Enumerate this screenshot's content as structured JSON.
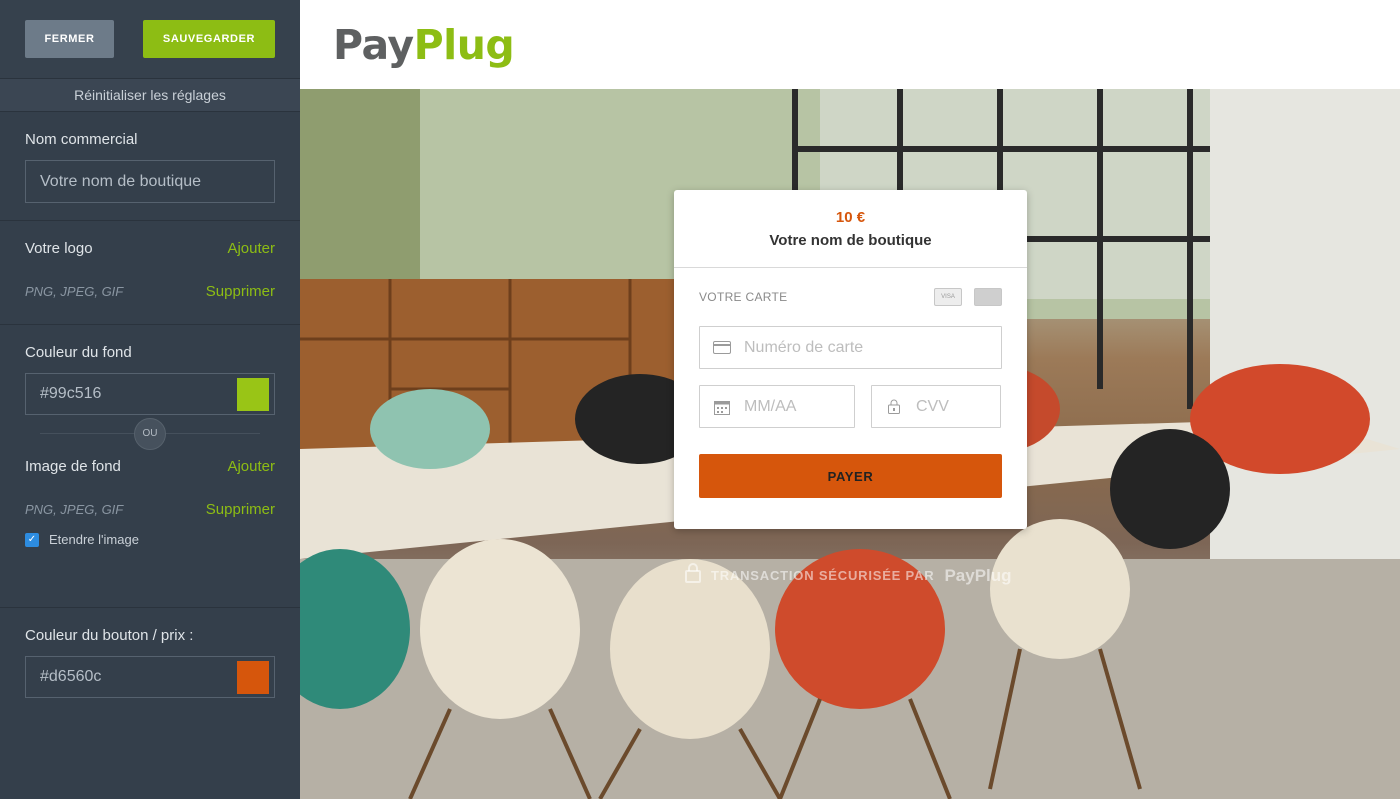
{
  "sidebar": {
    "close_label": "FERMER",
    "save_label": "SAUVEGARDER",
    "reset_label": "Réinitialiser les réglages",
    "commercial_name": {
      "label": "Nom commercial",
      "placeholder": "Votre nom de boutique"
    },
    "logo": {
      "label": "Votre logo",
      "add": "Ajouter",
      "formats": "PNG, JPEG, GIF",
      "remove": "Supprimer"
    },
    "bg_color": {
      "label": "Couleur du fond",
      "value": "#99c516",
      "swatch": "#99c516"
    },
    "or_label": "OU",
    "bg_image": {
      "label": "Image de fond",
      "add": "Ajouter",
      "formats": "PNG, JPEG, GIF",
      "remove": "Supprimer",
      "stretch_label": "Etendre l'image",
      "stretch_checked": true
    },
    "button_color": {
      "label": "Couleur du bouton / prix :",
      "value": "#d6560c",
      "swatch": "#d6560c"
    }
  },
  "header": {
    "logo_pay": "Pay",
    "logo_plug": "Plug"
  },
  "payment": {
    "price": "10 €",
    "shop_name": "Votre nom de boutique",
    "card_label": "VOTRE CARTE",
    "brand_icons": [
      "visa-icon",
      "mastercard-icon"
    ],
    "card_number_placeholder": "Numéro de carte",
    "expiry_placeholder": "MM/AA",
    "cvv_placeholder": "CVV",
    "pay_label": "PAYER"
  },
  "footer": {
    "secure_text": "TRANSACTION SÉCURISÉE PAR",
    "brand": "PayPlug"
  },
  "colors": {
    "sidebar_bg": "#343f4b",
    "accent_green": "#8dbd14",
    "accent_orange": "#d6560c"
  }
}
